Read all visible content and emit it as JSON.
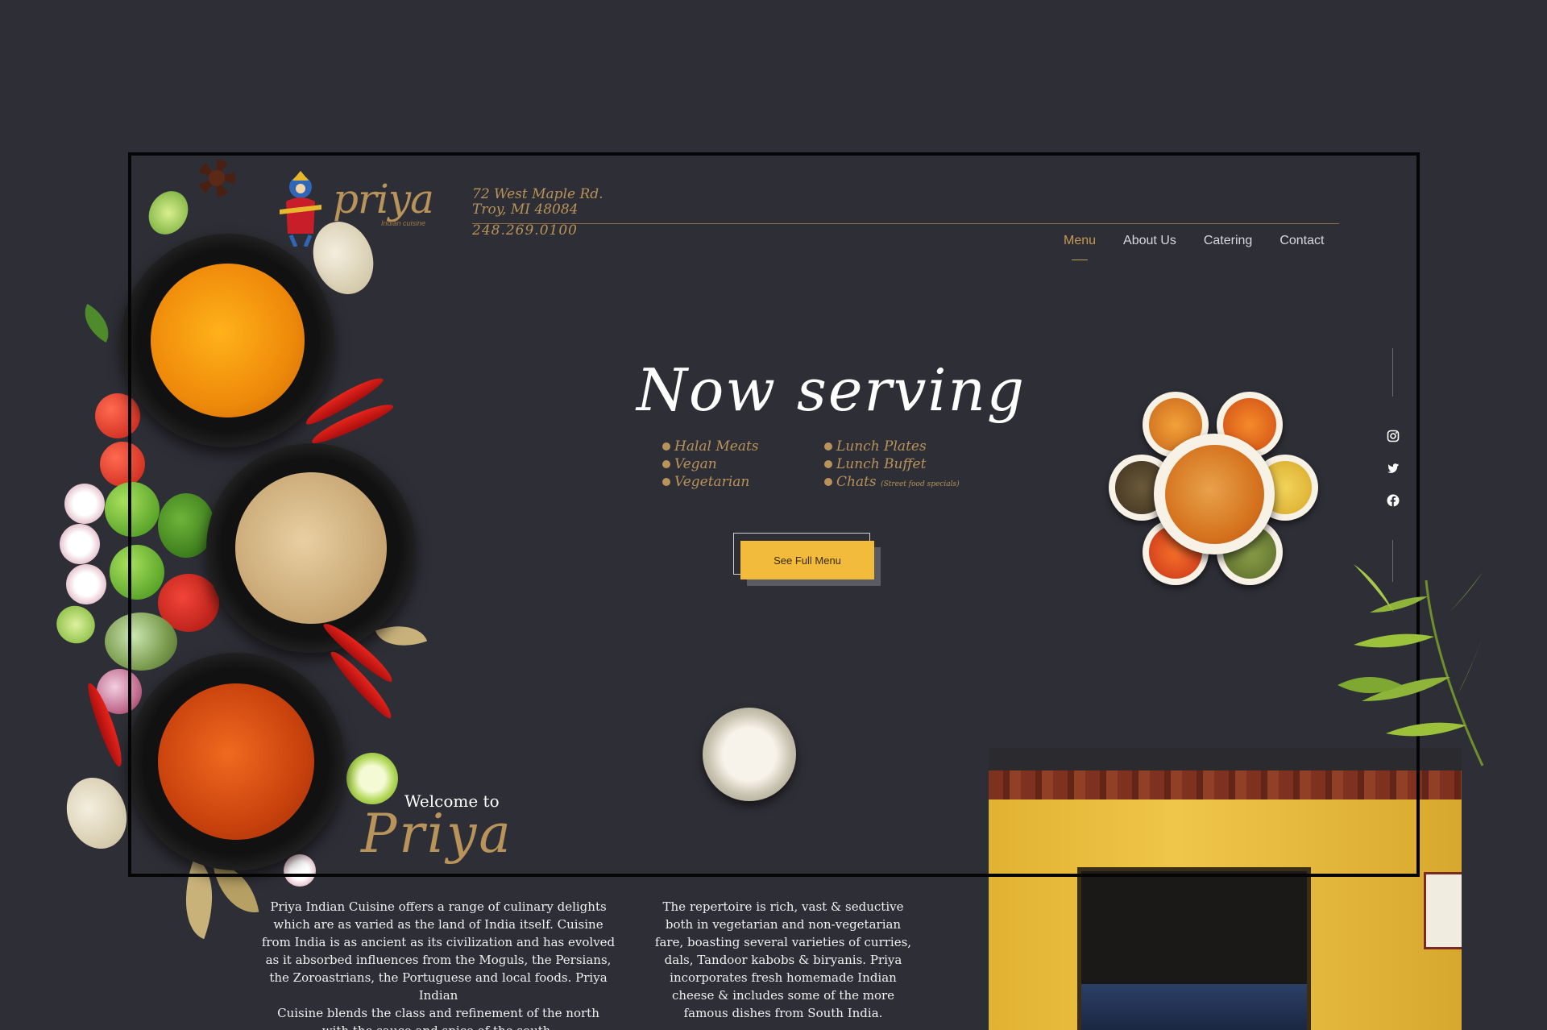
{
  "header": {
    "logo_word": "priya",
    "logo_tagline": "Indian cuisine",
    "address_line1": "72 West Maple Rd.",
    "address_line2": "Troy, MI 48084",
    "phone": "248.269.0100"
  },
  "nav": {
    "items": [
      {
        "label": "Menu",
        "active": true
      },
      {
        "label": "About Us",
        "active": false
      },
      {
        "label": "Catering",
        "active": false
      },
      {
        "label": "Contact",
        "active": false
      }
    ]
  },
  "hero": {
    "title": "Now serving",
    "left_items": [
      "Halal Meats",
      "Vegan",
      "Vegetarian"
    ],
    "right_items": [
      "Lunch Plates",
      "Lunch Buffet",
      "Chats"
    ],
    "chats_note": "(Street food specials)",
    "button_label": "See Full Menu"
  },
  "social": {
    "icons": [
      "instagram-icon",
      "twitter-icon",
      "facebook-icon"
    ]
  },
  "welcome": {
    "intro": "Welcome to",
    "name": "Priya",
    "paragraph1": [
      "Priya Indian Cuisine offers a range of culinary delights",
      "which are as varied as the land of India itself. Cuisine",
      "from India is as ancient as its civilization and has evolved",
      "as it absorbed influences from the Moguls, the Persians,",
      "the Zoroastrians, the Portuguese and local foods. Priya Indian",
      "Cuisine blends the class and refinement of the north",
      "with the sauce and spice of the south."
    ],
    "paragraph2": [
      "The repertoire is rich, vast & seductive",
      "both in vegetarian and non-vegetarian",
      "fare, boasting several varieties of curries,",
      "dals, Tandoor kabobs & biryanis. Priya",
      "incorporates fresh homemade Indian",
      "cheese & includes some of the more",
      "famous dishes from South India."
    ]
  },
  "colors": {
    "background": "#2e2e36",
    "gold": "#b8935a",
    "accent_button": "#f3bb3b",
    "frame": "#050506"
  }
}
